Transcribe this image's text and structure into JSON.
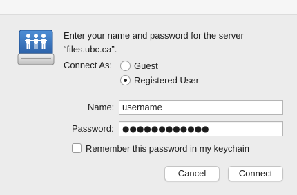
{
  "dialog": {
    "message_line1": "Enter your name and password for the server",
    "message_line2": "“files.ubc.ca”.",
    "server_icon": "network-server-icon"
  },
  "connect_as": {
    "label": "Connect As:",
    "options": [
      {
        "label": "Guest",
        "selected": false
      },
      {
        "label": "Registered User",
        "selected": true
      }
    ]
  },
  "fields": {
    "name_label": "Name:",
    "name_value": "username",
    "password_label": "Password:",
    "password_value": "●●●●●●●●●●●●"
  },
  "remember": {
    "label": "Remember this password in my keychain",
    "checked": false
  },
  "buttons": {
    "cancel": "Cancel",
    "connect": "Connect"
  },
  "colors": {
    "window_bg": "#ececec",
    "icon_blue": "#2f6fbe"
  }
}
